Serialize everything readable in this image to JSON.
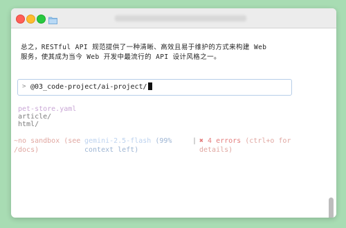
{
  "paragraph": {
    "line1": "总之，RESTful API 规范提供了一种清晰、高效且易于维护的方式来构建 Web",
    "line2": "服务，使其成为当今 Web 开发中最流行的 API 设计风格之一。"
  },
  "input": {
    "prompt": ">",
    "value": "@03_code-project/ai-project/"
  },
  "files": [
    "pet-store.yaml",
    "article/",
    "html/"
  ],
  "status": {
    "sandbox_line1": "~no sandbox (see",
    "sandbox_line2": "/docs)",
    "model_name": "gemini-2.5-flash",
    "model_pct": "(99%",
    "model_line2": "context left)",
    "separator": "|",
    "errors": "✖ 4 errors",
    "errors_hint": "(ctrl+o for",
    "errors_line2": "details)"
  },
  "colors": {
    "background": "#a8dcb3",
    "error": "#e0a6a0",
    "file_highlight": "#c9a7d6",
    "model": "#9cb4d3",
    "input_border": "#b6cde8"
  }
}
